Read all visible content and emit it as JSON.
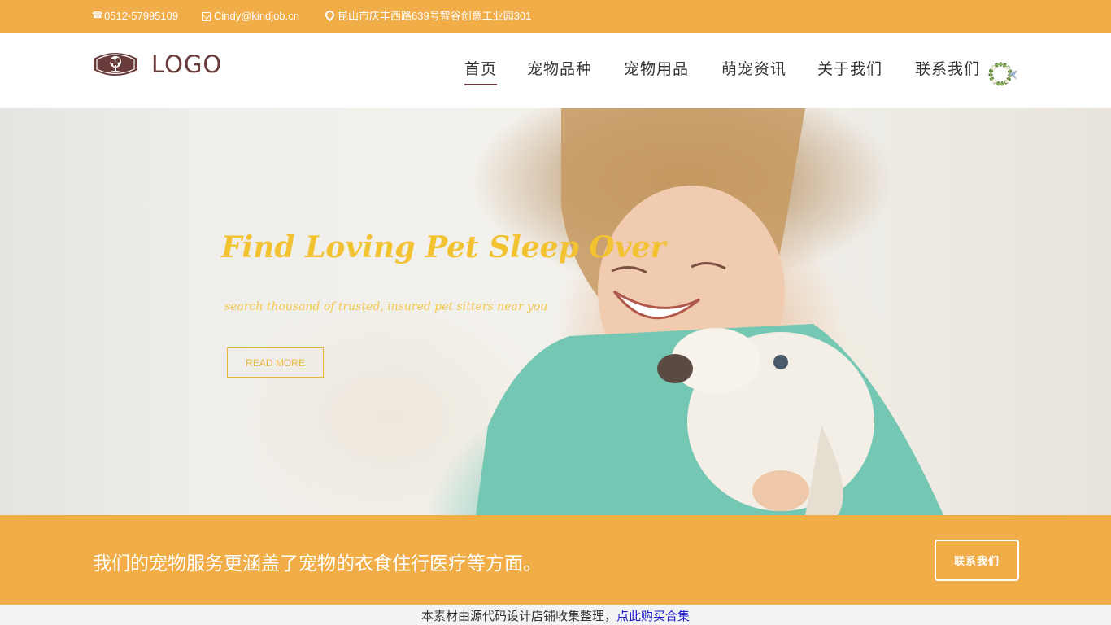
{
  "topbar": {
    "phone": "0512-57995109",
    "email": "Cindy@kindjob.cn",
    "address": "昆山市庆丰西路639号智谷创意工业园301",
    "icons": [
      "phone-icon",
      "mail-icon",
      "map-pin-icon"
    ]
  },
  "header": {
    "logo_text": "LOGO",
    "nav": [
      {
        "label": "首页",
        "active": true
      },
      {
        "label": "宠物品种",
        "active": false
      },
      {
        "label": "宠物用品",
        "active": false
      },
      {
        "label": "萌宠资讯",
        "active": false
      },
      {
        "label": "关于我们",
        "active": false
      },
      {
        "label": "联系我们",
        "active": false
      }
    ]
  },
  "hero": {
    "title": "Find Loving Pet Sleep Over",
    "subtitle": "search thousand of trusted,  insured pet sitters near you",
    "button_label": "READ MORE",
    "accent_color": "#f3c230"
  },
  "banner": {
    "text": "我们的宠物服务更涵盖了宠物的衣食住行医疗等方面。",
    "button_label": "联系我们",
    "background": "#f0ad48"
  },
  "footer": {
    "note": "本素材由源代码设计店铺收集整理，",
    "link": "点此购买合集"
  },
  "colors": {
    "brand_orange": "#f0ad48",
    "logo_brown": "#6a3b3b",
    "link_blue": "#1a1acc"
  }
}
